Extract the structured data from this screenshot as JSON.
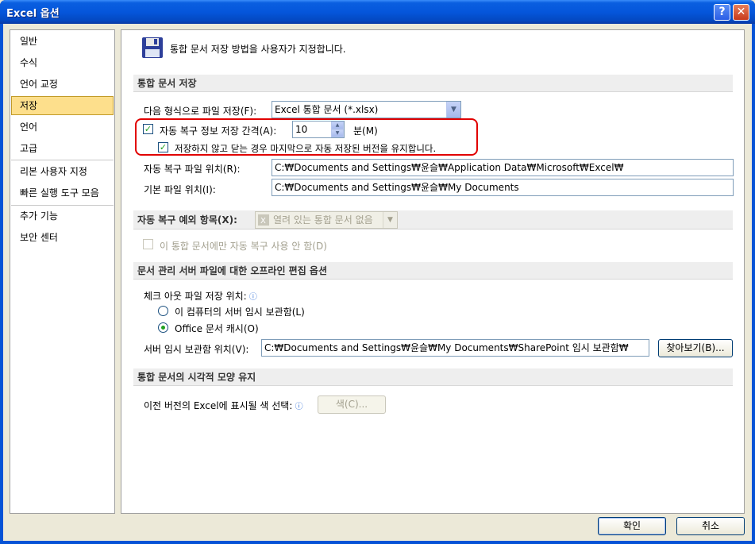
{
  "window": {
    "title": "Excel 옵션",
    "help_icon": "?",
    "close_icon": "✕"
  },
  "sidebar": {
    "items": [
      {
        "label": "일반"
      },
      {
        "label": "수식"
      },
      {
        "label": "언어 교정"
      },
      {
        "label": "저장",
        "selected": true
      },
      {
        "label": "언어"
      },
      {
        "label": "고급"
      },
      {
        "label": "리본 사용자 지정"
      },
      {
        "label": "빠른 실행 도구 모음"
      },
      {
        "label": "추가 기능"
      },
      {
        "label": "보안 센터"
      }
    ]
  },
  "header": {
    "icon": "floppy-disk-icon",
    "text": "통합 문서 저장 방법을 사용자가 지정합니다."
  },
  "save_section": {
    "title": "통합 문서 저장",
    "format_label": "다음 형식으로 파일 저장(F):",
    "format_value": "Excel 통합 문서 (*.xlsx)",
    "autorecover_label": "자동 복구 정보 저장 간격(A):",
    "autorecover_checked": true,
    "autorecover_minutes": "10",
    "minutes_label": "분(M)",
    "keep_last_label": "저장하지 않고 닫는 경우 마지막으로 자동 저장된 버전을 유지합니다.",
    "keep_last_checked": true,
    "autorecover_location_label": "자동 복구 파일 위치(R):",
    "autorecover_location_value": "C:₩Documents and Settings₩윤슬₩Application Data₩Microsoft₩Excel₩",
    "default_location_label": "기본 파일 위치(I):",
    "default_location_value": "C:₩Documents and Settings₩윤슬₩My Documents"
  },
  "exceptions_section": {
    "title": "자동 복구 예외 항목(X):",
    "workbook_value": "열려 있는 통합 문서 없음",
    "disable_label": "이 통합 문서에만 자동 복구 사용 안 함(D)"
  },
  "offline_section": {
    "title": "문서 관리 서버 파일에 대한 오프라인 편집 옵션",
    "checkout_label": "체크 아웃 파일 저장 위치:",
    "option_server_drafts": "이 컴퓨터의 서버 임시 보관함(L)",
    "option_office_cache": "Office 문서 캐시(O)",
    "server_drafts_label": "서버 임시 보관함 위치(V):",
    "server_drafts_value": "C:₩Documents and Settings₩윤슬₩My Documents₩SharePoint 임시 보관함₩",
    "browse_label": "찾아보기(B)..."
  },
  "visual_section": {
    "title": "통합 문서의 시각적 모양 유지",
    "color_label": "이전 버전의 Excel에 표시될 색 선택:",
    "colors_button": "색(C)..."
  },
  "footer": {
    "ok_label": "확인",
    "cancel_label": "취소"
  },
  "colors": {
    "accent_selection": "#fddf8c",
    "highlight_border": "#e10000",
    "titlebar": "#0556db"
  }
}
